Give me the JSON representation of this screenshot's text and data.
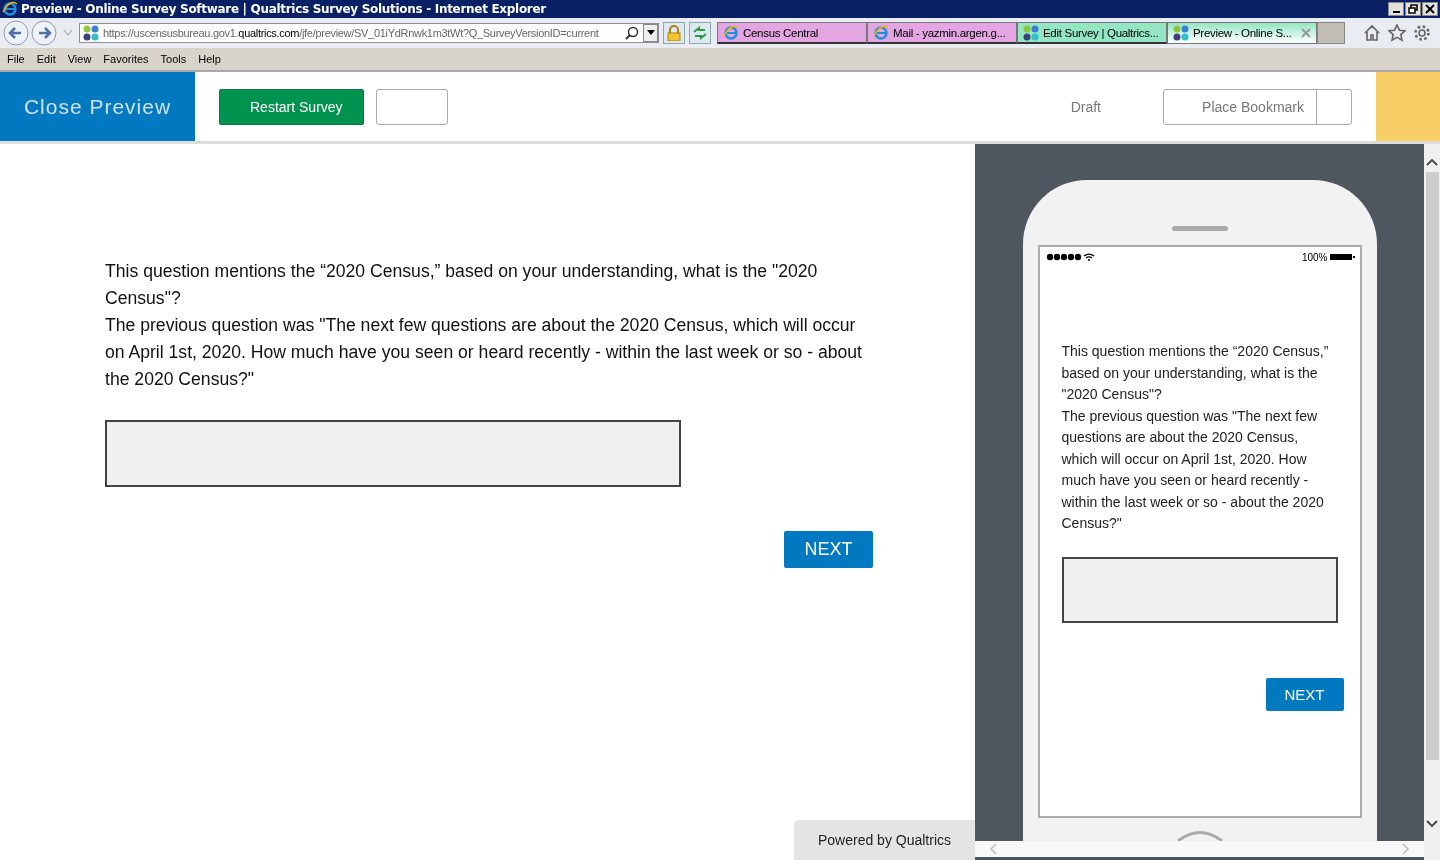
{
  "window": {
    "title": "Preview - Online Survey Software | Qualtrics Survey Solutions - Internet Explorer"
  },
  "address_bar": {
    "url_prefix": "https://uscensusbureau.gov1.",
    "url_domain": "qualtrics.com",
    "url_rest": "/jfe/preview/SV_01iYdRnwk1m3tWt?Q_SurveyVersionID=current"
  },
  "tabs": [
    {
      "label": "Census Central",
      "color": "#e3a6e3",
      "selected": false,
      "closable": false
    },
    {
      "label": "Mail - yazmin.argen.g...",
      "color": "#e3a6e3",
      "selected": false,
      "closable": false
    },
    {
      "label": "Edit Survey | Qualtrics...",
      "color": "#94e6c4",
      "selected": false,
      "closable": false
    },
    {
      "label": "Preview - Online S...",
      "color": "#94e6c4",
      "selected": true,
      "closable": true
    }
  ],
  "menu": [
    "File",
    "Edit",
    "View",
    "Favorites",
    "Tools",
    "Help"
  ],
  "header": {
    "close_preview": "Close Preview",
    "restart": "Restart Survey",
    "status": "Draft",
    "bookmark": "Place Bookmark"
  },
  "question": {
    "lines": [
      "This question mentions the “2020 Census,” based on your understanding, what is the \"2020 Census\"?",
      "The previous question was \"The next few questions are about the 2020 Census, which will occur on April 1st, 2020. How much have you seen or heard recently - within the last week or so - about the 2020 Census?\""
    ],
    "next": "NEXT"
  },
  "mobile_preview": {
    "battery": "100%",
    "lines": [
      "This question mentions the “2020 Census,” based on your understanding, what is the \"2020 Census\"?",
      "The previous question was \"The next few questions are about the 2020 Census, which will occur on April 1st, 2020. How much have you seen or heard recently - within the last week or so - about the 2020 Census?\""
    ],
    "next": "NEXT"
  },
  "footer": {
    "powered_by": "Powered by Qualtrics"
  }
}
